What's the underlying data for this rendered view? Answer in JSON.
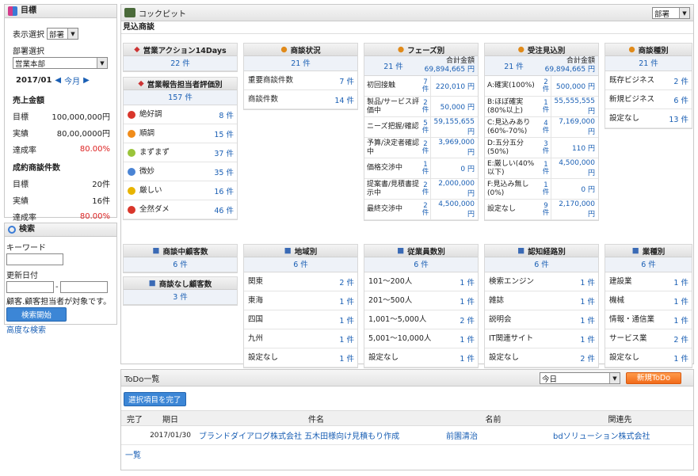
{
  "goals": {
    "title": "目標",
    "display_label": "表示選択",
    "display_value": "部署",
    "dept_label": "部署選択",
    "dept_value": "営業本部",
    "date": "2017/01",
    "this_month": "今月",
    "sales_title": "売上金額",
    "sales_target_label": "目標",
    "sales_target": "100,000,000円",
    "sales_actual_label": "実績",
    "sales_actual": "80,00,0000円",
    "sales_rate_label": "達成率",
    "sales_rate": "80.00%",
    "deals_title": "成約商談件数",
    "deals_target_label": "目標",
    "deals_target": "20件",
    "deals_actual_label": "実績",
    "deals_actual": "16件",
    "deals_rate_label": "達成率",
    "deals_rate": "80.00%"
  },
  "search": {
    "title": "検索",
    "keyword_label": "キーワード",
    "updated_label": "更新日付",
    "note": "顧客.顧客担当者が対象です。",
    "button": "検索開始",
    "advanced": "高度な検索"
  },
  "cockpit": {
    "title": "コックピット",
    "select_value": "部署",
    "section": "見込商談"
  },
  "cards": {
    "action": {
      "title": "営業アクション14Days",
      "total": "22 件"
    },
    "eval": {
      "title": "営業報告担当者評価別",
      "total": "157 件",
      "rows": [
        {
          "label": "絶好調",
          "value": "8 件",
          "icon": "angry-face-icon",
          "color": "#d9362b"
        },
        {
          "label": "順調",
          "value": "15 件",
          "icon": "sad-face-icon",
          "color": "#f08c1a"
        },
        {
          "label": "まずまず",
          "value": "37 件",
          "icon": "smile-face-icon",
          "color": "#9ac43a"
        },
        {
          "label": "微妙",
          "value": "35 件",
          "icon": "neutral-face-icon",
          "color": "#4a84d4"
        },
        {
          "label": "厳しい",
          "value": "16 件",
          "icon": "warning-icon",
          "color": "#e8b400"
        },
        {
          "label": "全然ダメ",
          "value": "46 件",
          "icon": "cross-icon",
          "color": "#d9362b"
        }
      ]
    },
    "status": {
      "title": "商談状況",
      "total": "21 件",
      "rows": [
        {
          "label": "重要商談件数",
          "value": "7 件"
        },
        {
          "label": "商談件数",
          "value": "14 件"
        }
      ]
    },
    "phase": {
      "title": "フェーズ別",
      "total": "21 件",
      "sum_label": "合計金額",
      "sum": "69,894,665 円",
      "rows": [
        {
          "label": "初回接触",
          "count": "7 件",
          "amount": "220,010 円"
        },
        {
          "label": "製品/サービス評価中",
          "count": "2 件",
          "amount": "50,000 円"
        },
        {
          "label": "ニーズ把握/確認",
          "count": "5 件",
          "amount": "59,155,655 円"
        },
        {
          "label": "予算/決定者確認中",
          "count": "2 件",
          "amount": "3,969,000 円"
        },
        {
          "label": "価格交渉中",
          "count": "1 件",
          "amount": "0 円"
        },
        {
          "label": "提案書/見積書提示中",
          "count": "2 件",
          "amount": "2,000,000 円"
        },
        {
          "label": "最終交渉中",
          "count": "2 件",
          "amount": "4,500,000 円"
        }
      ]
    },
    "forecast": {
      "title": "受注見込別",
      "total": "21 件",
      "sum_label": "合計金額",
      "sum": "69,894,665 円",
      "rows": [
        {
          "label": "A:確実(100%)",
          "count": "2 件",
          "amount": "500,000 円"
        },
        {
          "label": "B:ほぼ確実(80%以上)",
          "count": "1 件",
          "amount": "55,555,555 円"
        },
        {
          "label": "C:見込みあり(60%-70%)",
          "count": "4 件",
          "amount": "7,169,000 円"
        },
        {
          "label": "D:五分五分(50%)",
          "count": "3 件",
          "amount": "110 円"
        },
        {
          "label": "E:厳しい(40%以下)",
          "count": "1 件",
          "amount": "4,500,000 円"
        },
        {
          "label": "F:見込み無し(0%)",
          "count": "1 件",
          "amount": "0 円"
        },
        {
          "label": "設定なし",
          "count": "9 件",
          "amount": "2,170,000 円"
        }
      ]
    },
    "kind": {
      "title": "商談種別",
      "total": "21 件",
      "rows": [
        {
          "label": "既存ビジネス",
          "value": "2 件"
        },
        {
          "label": "新規ビジネス",
          "value": "6 件"
        },
        {
          "label": "設定なし",
          "value": "13 件"
        }
      ]
    },
    "inprog": {
      "title": "商談中顧客数",
      "total": "6 件"
    },
    "none": {
      "title": "商談なし顧客数",
      "total": "3 件"
    },
    "region": {
      "title": "地域別",
      "total": "6 件",
      "rows": [
        {
          "label": "関東",
          "value": "2 件"
        },
        {
          "label": "東海",
          "value": "1 件"
        },
        {
          "label": "四国",
          "value": "1 件"
        },
        {
          "label": "九州",
          "value": "1 件"
        },
        {
          "label": "設定なし",
          "value": "1 件"
        }
      ]
    },
    "employees": {
      "title": "従業員数別",
      "total": "6 件",
      "rows": [
        {
          "label": "101〜200人",
          "value": "1 件"
        },
        {
          "label": "201〜500人",
          "value": "1 件"
        },
        {
          "label": "1,001〜5,000人",
          "value": "2 件"
        },
        {
          "label": "5,001〜10,000人",
          "value": "1 件"
        },
        {
          "label": "設定なし",
          "value": "1 件"
        }
      ]
    },
    "channel": {
      "title": "認知経路別",
      "total": "6 件",
      "rows": [
        {
          "label": "検索エンジン",
          "value": "1 件"
        },
        {
          "label": "雑誌",
          "value": "1 件"
        },
        {
          "label": "説明会",
          "value": "1 件"
        },
        {
          "label": "IT関連サイト",
          "value": "1 件"
        },
        {
          "label": "設定なし",
          "value": "2 件"
        }
      ]
    },
    "industry": {
      "title": "業種別",
      "total": "6 件",
      "rows": [
        {
          "label": "建設業",
          "value": "1 件"
        },
        {
          "label": "機械",
          "value": "1 件"
        },
        {
          "label": "情報・通信業",
          "value": "1 件"
        },
        {
          "label": "サービス業",
          "value": "2 件"
        },
        {
          "label": "設定なし",
          "value": "1 件"
        }
      ]
    }
  },
  "todo": {
    "title": "ToDo一覧",
    "filter": "今日",
    "new_button": "新規ToDo",
    "complete_button": "選択項目を完了",
    "headers": [
      "完了",
      "期日",
      "件名",
      "名前",
      "関連先"
    ],
    "row": {
      "date": "2017/01/30",
      "subject": "ブランドダイアログ株式会社 五木田様向け見積もり作成",
      "name": "前園清治",
      "related": "bdソリューション株式会社"
    },
    "list_link": "一覧"
  }
}
